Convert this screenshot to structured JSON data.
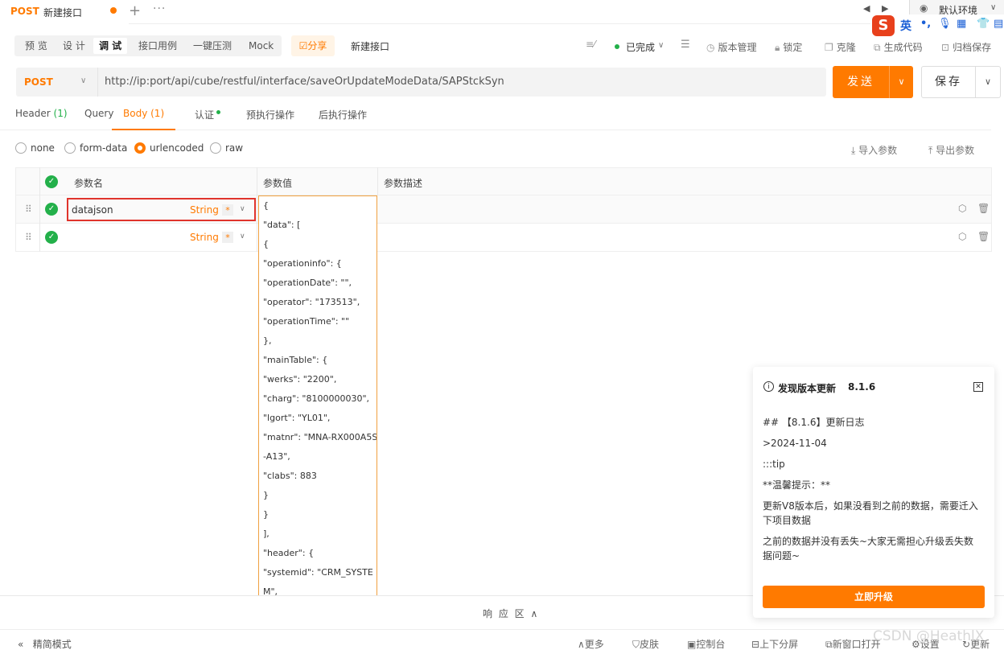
{
  "tabs": {
    "method": "POST",
    "title": "新建接口",
    "plus": "+",
    "more": "···"
  },
  "env": {
    "label": "默认环境"
  },
  "ime": {
    "logo": "S",
    "lang": "英",
    "punct": "•,"
  },
  "modes": {
    "preview": "预 览",
    "design": "设 计",
    "debug": "调 试",
    "cases": "接口用例",
    "stress": "一键压测",
    "mock": "Mock"
  },
  "share": "☑分享",
  "api_name": "新建接口",
  "status": "已完成",
  "tools": {
    "version": "版本管理",
    "lock": "锁定",
    "clone": "克隆",
    "codegen": "生成代码",
    "archive": "归档保存"
  },
  "request": {
    "method": "POST",
    "url": "http://ip:port/api/cube/restful/interface/saveOrUpdateModeData/SAPStckSyn",
    "send": "发送",
    "save": "保存"
  },
  "req_tabs": {
    "header": "Header",
    "header_count": "(1)",
    "query": "Query",
    "body": "Body",
    "body_count": "(1)",
    "auth": "认证",
    "pre": "预执行操作",
    "post": "后执行操作"
  },
  "body_types": {
    "none": "none",
    "form": "form-data",
    "urlencoded": "urlencoded",
    "raw": "raw",
    "selected": "urlencoded"
  },
  "import": "导入参数",
  "export": "导出参数",
  "table": {
    "col_name": "参数名",
    "col_value": "参数值",
    "col_desc": "参数描述",
    "rows": [
      {
        "name": "datajson",
        "type": "String",
        "required": "*"
      },
      {
        "name": "",
        "type": "String",
        "required": "*"
      }
    ]
  },
  "value_lines": [
    "{",
    "\"data\": [",
    "{",
    "\"operationinfo\": {",
    "\"operationDate\": \"\",",
    "\"operator\": \"173513\",",
    "\"operationTime\": \"\"",
    "},",
    "\"mainTable\": {",
    "\"werks\": \"2200\",",
    "\"charg\": \"8100000030\",",
    "\"lgort\": \"YL01\",",
    "\"matnr\": \"MNA-RX000A5S",
    "-A13\",",
    "\"clabs\": 883",
    "}",
    "}",
    "],",
    "\"header\": {",
    "\"systemid\": \"CRM_SYSTE",
    "M\","
  ],
  "response": "响 应 区",
  "status_bar": {
    "compact": "精简模式",
    "more": "更多",
    "skin": "皮肤",
    "console": "控制台",
    "split": "上下分屏",
    "new_window": "新窗口打开",
    "settings": "设置",
    "update": "更新"
  },
  "watermark": "CSDN @HeathlX",
  "update_popup": {
    "title": "发现版本更新",
    "version": "8.1.6",
    "lines": [
      "## 【8.1.6】更新日志",
      ">2024-11-04",
      ":::tip",
      "**温馨提示：**",
      "更新V8版本后，如果没看到之前的数据，需要迁入下项目数据",
      "之前的数据并没有丢失~大家无需担心升级丢失数据问题~"
    ],
    "button": "立即升级"
  },
  "colors": {
    "accent": "#ff7a00",
    "success": "#23b04a",
    "highlight": "#e0342c"
  }
}
